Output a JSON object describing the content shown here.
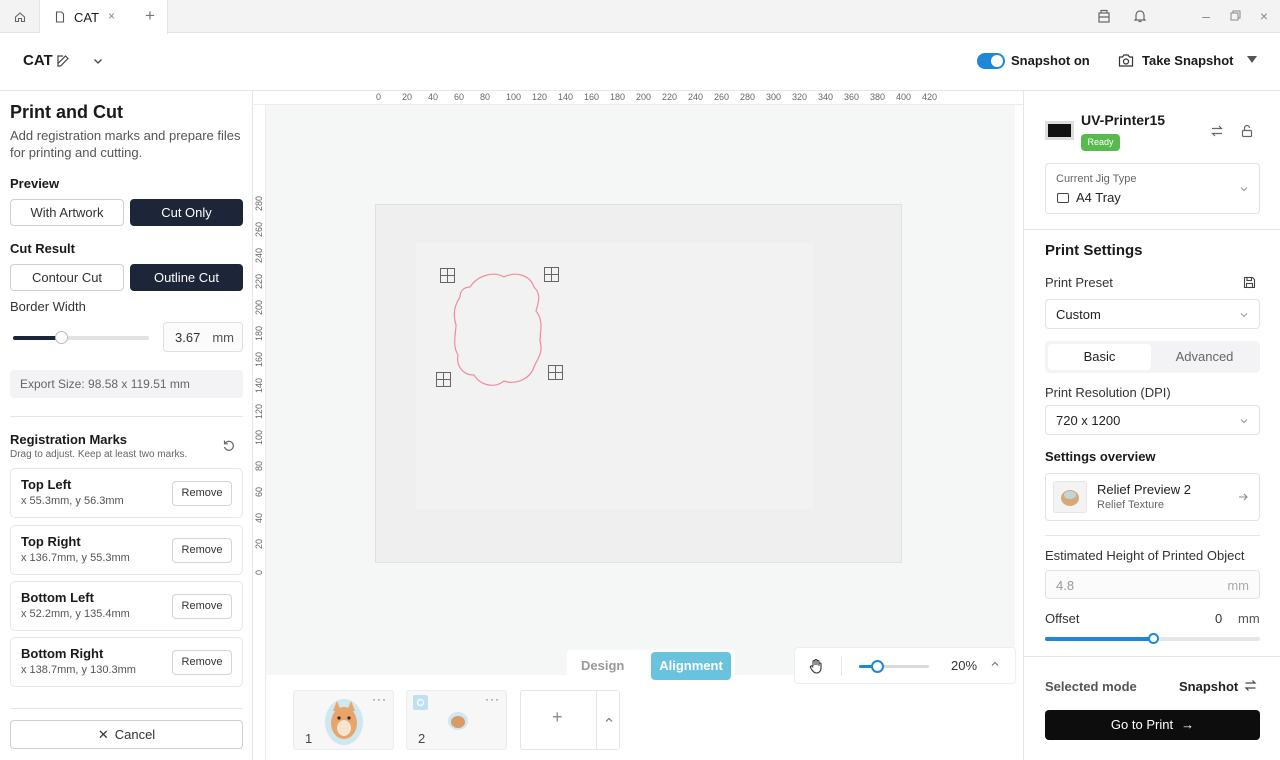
{
  "titlebar": {
    "tab_title": "CAT",
    "close_glyph": "×",
    "new_tab_glyph": "+",
    "icons": [
      "home-icon",
      "document-icon",
      "package-icon",
      "bell-icon",
      "minimize-icon",
      "restore-icon",
      "close-window-icon"
    ]
  },
  "header": {
    "project_name": "CAT",
    "snapshot_toggle_label": "Snapshot on",
    "snapshot_on": true,
    "take_snapshot_label": "Take Snapshot"
  },
  "left": {
    "title": "Print and Cut",
    "subtitle": "Add registration marks and prepare files for printing and cutting.",
    "preview_label": "Preview",
    "preview_options": [
      "With Artwork",
      "Cut Only"
    ],
    "preview_selected": "Cut Only",
    "cut_result_label": "Cut Result",
    "cut_options": [
      "Contour Cut",
      "Outline Cut"
    ],
    "cut_selected": "Outline Cut",
    "border_width_label": "Border Width",
    "border_width_value": "3.67",
    "border_width_unit": "mm",
    "border_width_fraction": 0.35,
    "export_size": "Export Size: 98.58 x 119.51 mm",
    "reg_title": "Registration Marks",
    "reg_subtitle": "Drag to adjust. Keep at least two marks.",
    "marks": [
      {
        "name": "Top Left",
        "pos": "x 55.3mm, y 56.3mm",
        "remove": "Remove"
      },
      {
        "name": "Top Right",
        "pos": "x 136.7mm, y 55.3mm",
        "remove": "Remove"
      },
      {
        "name": "Bottom Left",
        "pos": "x 52.2mm, y 135.4mm",
        "remove": "Remove"
      },
      {
        "name": "Bottom Right",
        "pos": "x 138.7mm, y 130.3mm",
        "remove": "Remove"
      }
    ],
    "cancel_label": "Cancel"
  },
  "canvas": {
    "h_ruler": [
      "0",
      "20",
      "40",
      "60",
      "80",
      "100",
      "120",
      "140",
      "160",
      "180",
      "200",
      "220",
      "240",
      "260",
      "280",
      "300",
      "320",
      "340",
      "360",
      "380",
      "400",
      "420"
    ],
    "v_ruler": [
      "280",
      "260",
      "240",
      "220",
      "200",
      "180",
      "160",
      "140",
      "120",
      "100",
      "80",
      "60",
      "40",
      "20",
      "0"
    ],
    "view_tabs": [
      "Design",
      "Alignment"
    ],
    "view_selected": "Alignment",
    "zoom_value": "20%",
    "zoom_fraction": 0.25,
    "pages": [
      {
        "number": "1",
        "more": "···"
      },
      {
        "number": "2",
        "more": "···"
      }
    ]
  },
  "right": {
    "printer_name": "UV-Printer15",
    "printer_status": "Ready",
    "jig_label": "Current Jig Type",
    "jig_value": "A4 Tray",
    "print_settings_title": "Print Settings",
    "preset_label": "Print Preset",
    "preset_value": "Custom",
    "tabs": [
      "Basic",
      "Advanced"
    ],
    "tab_selected": "Basic",
    "resolution_label": "Print Resolution (DPI)",
    "resolution_value": "720 x 1200",
    "overview_title": "Settings overview",
    "overview_name": "Relief Preview 2",
    "overview_sub": "Relief Texture",
    "height_label": "Estimated Height of Printed Object",
    "height_placeholder": "4.8",
    "height_unit": "mm",
    "offset_label": "Offset",
    "offset_value": "0",
    "offset_unit": "mm",
    "offset_fraction": 0.5,
    "selected_mode_label": "Selected mode",
    "selected_mode_value": "Snapshot",
    "go_print_label": "Go to Print"
  },
  "colors": {
    "accent": "#1e88d8",
    "dark_button": "#1d2538",
    "alignment_tab": "#6ac3de",
    "ready_badge": "#58b94f",
    "cut_path": "#f08ca0"
  }
}
